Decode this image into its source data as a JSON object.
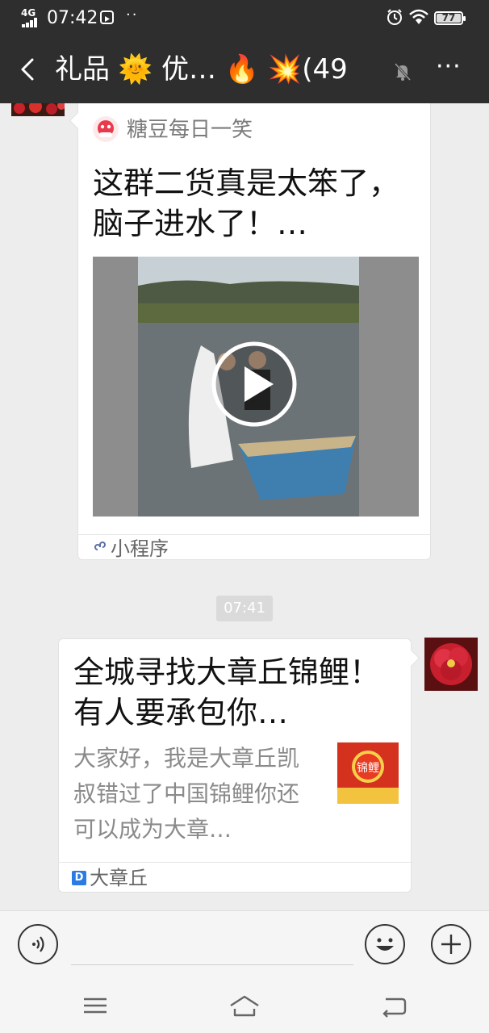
{
  "status_bar": {
    "network": "4G",
    "time": "07:42",
    "notification_dots": "··",
    "battery": "77"
  },
  "header": {
    "title": "礼品 🌞 优… 🔥 💥(49",
    "back_icon": "chevron-left-icon",
    "mute_icon": "bell-off-icon",
    "more_label": "···"
  },
  "messages": [
    {
      "type": "mini-program-card",
      "source_name": "糖豆每日一笑",
      "title": "这群二货真是太笨了，脑子进水了！…",
      "footer_label": "小程序",
      "play_icon": "play-icon"
    },
    {
      "type": "timestamp",
      "text": "07:41"
    },
    {
      "type": "article-card",
      "title": "全城寻找大章丘锦鲤！有人要承包你…",
      "description": "大家好，我是大章丘凯叔错过了中国锦鲤你还可以成为大章…",
      "thumb_text": "锦鲤",
      "footer_label": "大章丘"
    }
  ],
  "input_bar": {
    "voice_icon": "voice-icon",
    "emoji_icon": "emoji-icon",
    "add_icon": "plus-icon"
  },
  "nav_bar": {
    "menu_icon": "menu-icon",
    "home_icon": "home-icon",
    "back_icon": "back-icon"
  },
  "colors": {
    "header_bg": "#2e2e2e",
    "chat_bg": "#ededed",
    "card_bg": "#ffffff",
    "link_blue": "#2b7be4"
  }
}
